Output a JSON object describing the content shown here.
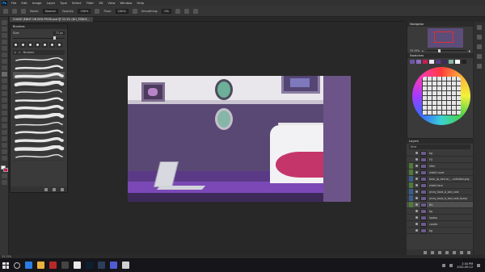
{
  "menubar": {
    "app_logo": "Ps",
    "items": [
      "File",
      "Edit",
      "Image",
      "Layer",
      "Type",
      "Select",
      "Filter",
      "3D",
      "View",
      "Window",
      "Help"
    ]
  },
  "options": {
    "mode_label": "Mode:",
    "mode_value": "Normal",
    "opacity_label": "Opacity:",
    "opacity_value": "100%",
    "flow_label": "Flow:",
    "flow_value": "100%",
    "smoothing_label": "Smoothing:",
    "smoothing_value": "0%"
  },
  "document": {
    "tab_label": "CHASE JENNY ON BED PROB.psd @ 33.3% (NO_FEBUS..."
  },
  "brush_panel": {
    "title": "Brushes",
    "size_label": "Size:",
    "size_value": "70 px",
    "size_level": 0.78,
    "folder_label": "Brushes",
    "selected_index": 2,
    "brush_count": 13
  },
  "navigator": {
    "title": "Navigator",
    "zoom_value": "33.33%",
    "zoom_level": 0.3
  },
  "swatches": {
    "title": "Swatches",
    "colors": [
      "#6e56a0",
      "#8b6fc0",
      "#c71f4e",
      "#e9e7ec",
      "#5a3a86",
      "#3d2a59",
      "#86b6a8",
      "#ffffff",
      "#222222"
    ]
  },
  "layers": {
    "title": "Layers",
    "filter_label": "Kind",
    "items": [
      {
        "name": "bg",
        "tag": "#3a3a3a"
      },
      {
        "name": "FG",
        "tag": "#3a3a3a"
      },
      {
        "name": "offer",
        "tag": "#4f7a3a"
      },
      {
        "name": "shield cover",
        "tag": "#4f7a3a"
      },
      {
        "name": "back_jw_bed on_...unfolded.png",
        "tag": "#3a5f8e"
      },
      {
        "name": "shield face",
        "tag": "#4f7a3a"
      },
      {
        "name": "jenny_tools_b_bed_nole",
        "tag": "#3a5f8e"
      },
      {
        "name": "jenny_tools_b_bed_nole_bump",
        "tag": "#3a5f8e"
      },
      {
        "name": "BG",
        "tag": "#4f7a3a"
      },
      {
        "name": "bg",
        "tag": "#3a3a3a"
      },
      {
        "name": "laptop",
        "tag": "#3a3a3a"
      },
      {
        "name": "candle",
        "tag": "#3a3a3a"
      },
      {
        "name": "bg",
        "tag": "#3a3a3a"
      }
    ],
    "selected_index": 8
  },
  "statusbar": {
    "zoom_text": "33.33%"
  },
  "taskbar": {
    "apps": [
      {
        "name": "edge",
        "color": "#2b7de1"
      },
      {
        "name": "files",
        "color": "#e9b23a"
      },
      {
        "name": "store",
        "color": "#b62828"
      },
      {
        "name": "media",
        "color": "#444444"
      },
      {
        "name": "chrome",
        "color": "#e9e9e9"
      },
      {
        "name": "photoshop",
        "color": "#0b2033"
      },
      {
        "name": "steam",
        "color": "#2a3f5a"
      },
      {
        "name": "discord",
        "color": "#4e5dd3"
      },
      {
        "name": "music",
        "color": "#d0d0d0"
      }
    ],
    "time": "2:34 PM",
    "date": "2021-09-12"
  }
}
